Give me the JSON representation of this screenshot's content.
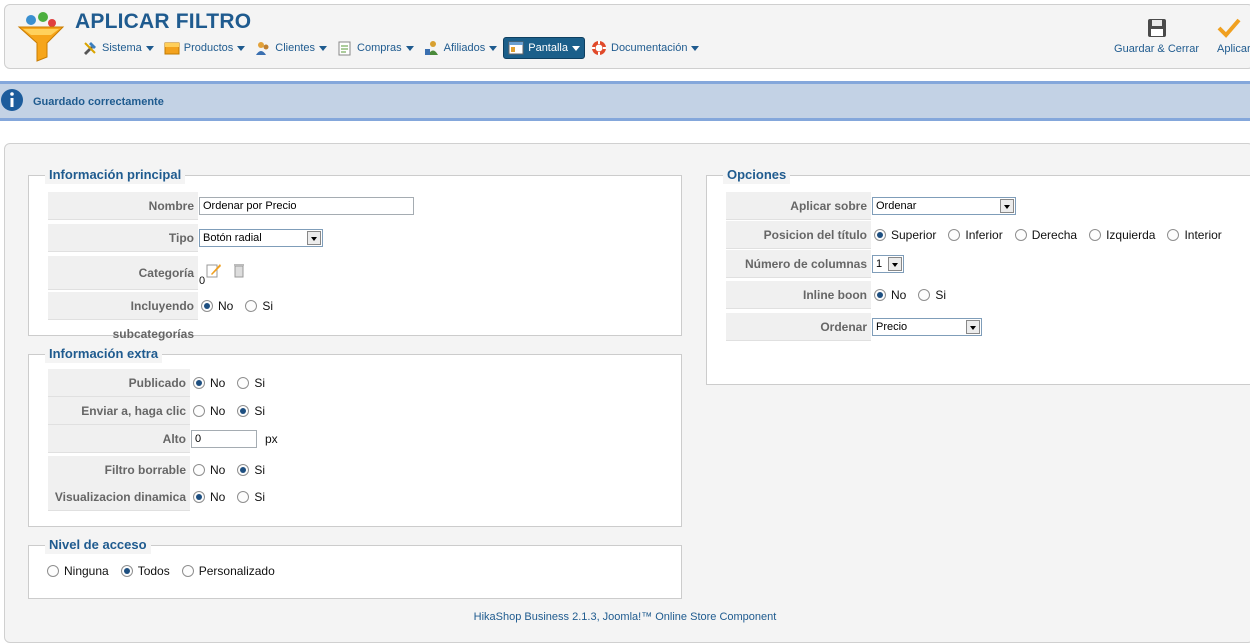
{
  "header": {
    "title": "APLICAR FILTRO",
    "menu": [
      {
        "label": "Sistema",
        "icon": "tools-icon"
      },
      {
        "label": "Productos",
        "icon": "products-icon"
      },
      {
        "label": "Clientes",
        "icon": "customers-icon"
      },
      {
        "label": "Compras",
        "icon": "orders-icon"
      },
      {
        "label": "Afiliados",
        "icon": "affiliates-icon"
      },
      {
        "label": "Pantalla",
        "icon": "display-icon",
        "active": true
      },
      {
        "label": "Documentación",
        "icon": "help-icon"
      }
    ],
    "toolbar": {
      "save_close_label": "Guardar & Cerrar",
      "apply_label": "Aplicar"
    }
  },
  "message": {
    "text": "Guardado correctamente",
    "icon": "info-icon"
  },
  "main_info": {
    "title": "Información principal",
    "nombre_label": "Nombre",
    "nombre_value": "Ordenar por Precio",
    "tipo_label": "Tipo",
    "tipo_value": "Botón radial",
    "categoria_label": "Categoría",
    "categoria_value": "0",
    "subcat_label": "Incluyendo subcategorías",
    "subcat_no": "No",
    "subcat_si": "Si"
  },
  "extra_info": {
    "title": "Información extra",
    "publicado_label": "Publicado",
    "enviar_label": "Enviar a, haga clic",
    "alto_label": "Alto",
    "alto_value": "0",
    "alto_unit": "px",
    "borrable_label": "Filtro borrable",
    "dinamica_label": "Visualizacion dinamica",
    "no": "No",
    "si": "Si"
  },
  "access": {
    "title": "Nivel de acceso",
    "ninguna": "Ninguna",
    "todos": "Todos",
    "personalizado": "Personalizado"
  },
  "options": {
    "title": "Opciones",
    "aplicar_label": "Aplicar sobre",
    "aplicar_value": "Ordenar",
    "posicion_label": "Posicion del título",
    "pos_superior": "Superior",
    "pos_inferior": "Inferior",
    "pos_derecha": "Derecha",
    "pos_izquierda": "Izquierda",
    "pos_interior": "Interior",
    "columnas_label": "Número de columnas",
    "columnas_value": "1",
    "inline_label": "Inline boon",
    "inline_no": "No",
    "inline_si": "Si",
    "ordenar_label": "Ordenar",
    "ordenar_value": "Precio"
  },
  "footer": {
    "text": "HikaShop Business 2.1.3, Joomla!™ Online Store Component"
  },
  "colors": {
    "accent": "#1f5b8f",
    "message_bg": "#c3d2e5",
    "message_border": "#84a7db",
    "active_menu": "#1b5f8a"
  }
}
